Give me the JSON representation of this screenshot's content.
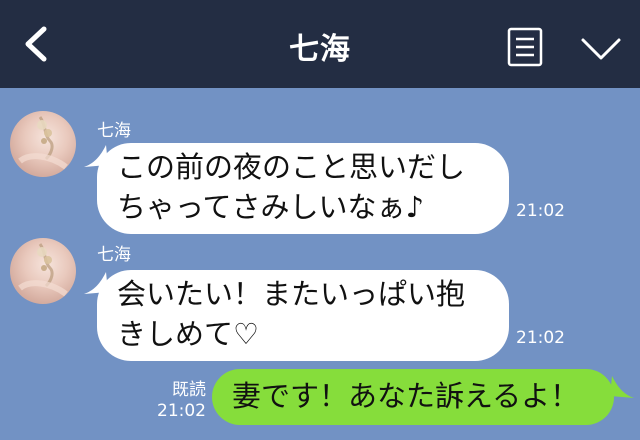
{
  "header": {
    "title": "七海",
    "back_icon": "chevron-left-icon",
    "menu_icon": "document-list-icon",
    "expand_icon": "chevron-down-icon"
  },
  "messages": [
    {
      "sender": "七海",
      "lines": [
        "この前の夜のこと思いだし",
        "ちゃってさみしいなぁ♪"
      ],
      "time": "21:02"
    },
    {
      "sender": "七海",
      "lines": [
        "会いたい！またいっぱい抱",
        "きしめて♡"
      ],
      "time": "21:02"
    },
    {
      "text": "妻です！あなた訴えるよ！",
      "read_label": "既読",
      "time": "21:02"
    }
  ],
  "colors": {
    "header_bg": "#232d43",
    "chat_bg": "#7292c4",
    "incoming_bubble": "#ffffff",
    "outgoing_bubble": "#86dd3b"
  }
}
